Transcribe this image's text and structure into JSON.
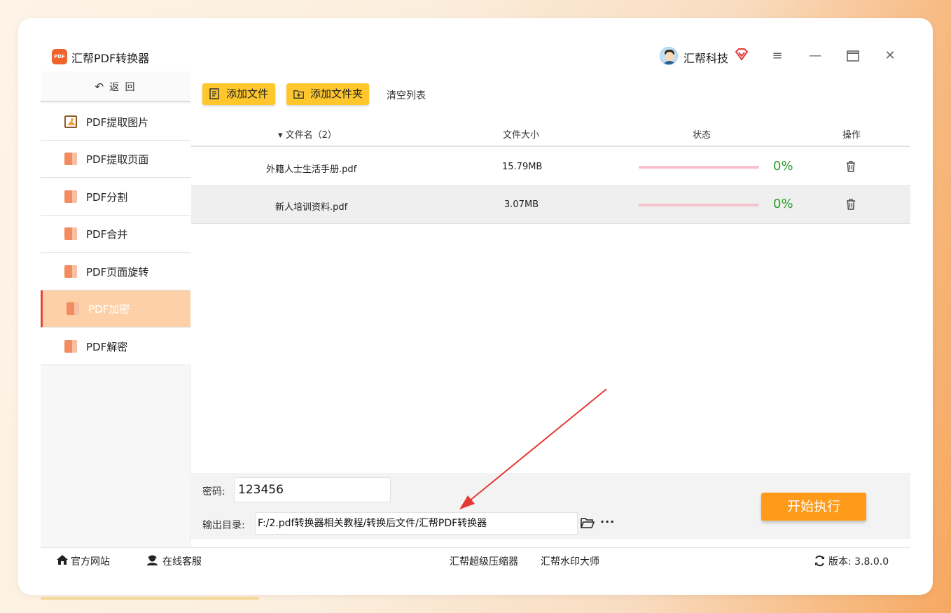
{
  "app": {
    "title": "汇帮PDF转换器",
    "logo_text": "PDF",
    "user_name": "汇帮科技"
  },
  "sidebar": {
    "back_label": "返 回",
    "items": [
      {
        "label": "PDF提取图片",
        "icon": "image-icon",
        "active": false
      },
      {
        "label": "PDF提取页面",
        "icon": "pdf-icon",
        "active": false
      },
      {
        "label": "PDF分割",
        "icon": "pdf-icon",
        "active": false
      },
      {
        "label": "PDF合并",
        "icon": "pdf-icon",
        "active": false
      },
      {
        "label": "PDF页面旋转",
        "icon": "pdf-icon",
        "active": false
      },
      {
        "label": "PDF加密",
        "icon": "pdf-icon",
        "active": true
      },
      {
        "label": "PDF解密",
        "icon": "pdf-icon",
        "active": false
      }
    ]
  },
  "toolbar": {
    "add_file": "添加文件",
    "add_folder": "添加文件夹",
    "clear_list": "清空列表"
  },
  "table": {
    "columns": [
      "▾ 文件名（2）",
      "文件大小",
      "状态",
      "操作"
    ],
    "rows": [
      {
        "name": "外籍人士生活手册.pdf",
        "size": "15.79MB",
        "progress": "0%"
      },
      {
        "name": "新人培训资料.pdf",
        "size": "3.07MB",
        "progress": "0%"
      }
    ]
  },
  "settings": {
    "password_label": "密码:",
    "password_value": "123456",
    "output_label": "输出目录:",
    "output_value": "F:/2.pdf转换器相关教程/转换后文件/汇帮PDF转换器",
    "more_label": "···",
    "start_button": "开始执行"
  },
  "statusbar": {
    "website": "官方网站",
    "support": "在线客服",
    "link1": "汇帮超级压缩器",
    "link2": "汇帮水印大师",
    "version": "版本: 3.8.0.0"
  },
  "colors": {
    "accent_orange": "#ff9a1a",
    "button_yellow": "#ffc72c",
    "active_nav_bg": "#fdd0a8",
    "progress_green": "#2a9d2a",
    "annotation_arrow": "#e53935"
  }
}
